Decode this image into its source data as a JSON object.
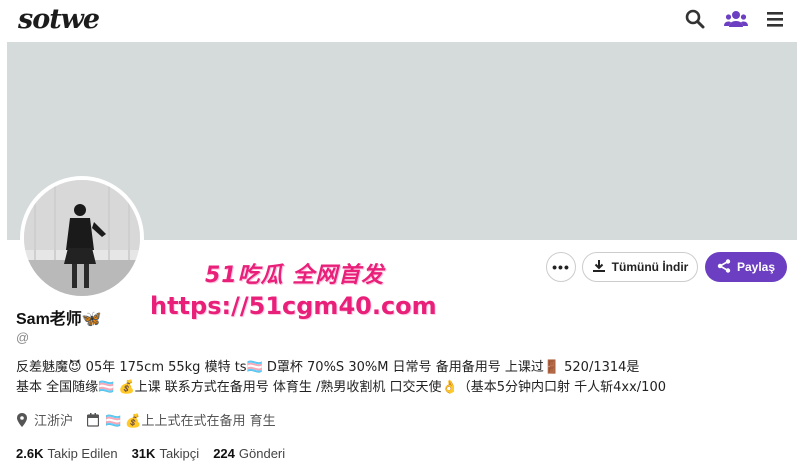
{
  "header": {
    "logo_text": "sotwe",
    "icons": [
      "search-icon",
      "users-icon",
      "menu-icon"
    ]
  },
  "profile": {
    "display_name": "Sam老师🦋",
    "handle": "@",
    "bio_line1": "反差魅魔😈 05年 175cm 55kg 模特 ts🏳️‍⚧️ D罩杯 70%S 30%M 日常号 备用备用号 上课过🚪 520/1314是",
    "bio_line2": "基本 全国随缘🏳️‍⚧️ 💰上课 联系方式在备用号 体育生 /熟男收割机 口交天使👌（基本5分钟内口射 千人斩4xx/100",
    "location": "江浙沪",
    "extra_meta": "🏳️‍⚧️ 💰上上式在式在备用 育生"
  },
  "actions": {
    "more_label": "•••",
    "download_label": "Tümünü İndir",
    "share_label": "Paylaş"
  },
  "watermark": {
    "top_text": "51吃瓜 全网首发",
    "url_text": "https://51cgm40.com"
  },
  "stats": [
    {
      "value": "2.6K",
      "label": "Takip Edilen"
    },
    {
      "value": "31K",
      "label": "Takipçi"
    },
    {
      "value": "224",
      "label": "Gönderi"
    }
  ],
  "colors": {
    "banner": "#d5dadb",
    "share_button": "#6c3ec1",
    "watermark": "#e8207a",
    "users_icon": "#6c3ec1"
  }
}
